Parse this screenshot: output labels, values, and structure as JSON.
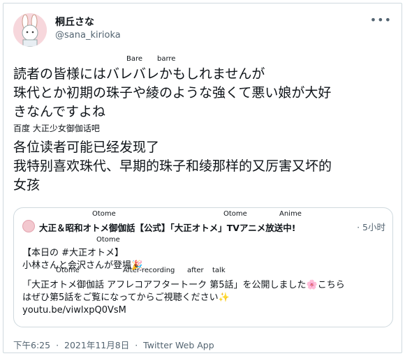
{
  "tweet": {
    "author_name": "桐丘さな",
    "author_handle": "@sana_kirioka",
    "more_icon": "more-dots-icon",
    "ruby_line1": [
      "Bare",
      "barre"
    ],
    "text_lines": [
      "読者の皆様にはバレバレかもしれませんが",
      "珠代とか初期の珠子や綾のような強くて悪い娘が大好",
      "きなんですよね"
    ],
    "translation_source": "百度 大正少女御伽话吧",
    "translation_lines": [
      "各位读者可能已经发现了",
      "我特别喜欢珠代、早期的珠子和绫那样的又厉害又坏的",
      "女孩"
    ]
  },
  "quoted": {
    "ruby_header": [
      "Otome",
      "Otome",
      "Anime"
    ],
    "name": "大正＆昭和オトメ御伽話【公式】「大正オトメ」TVアニメ放送中!",
    "time": "· 5小时",
    "ruby_line2": [
      "Otome"
    ],
    "ruby_line4": [
      "Otome",
      "After-recording",
      "after",
      "talk"
    ],
    "lines": [
      "【本日の #大正オトメ】",
      "小林さんと会沢さんが登場🎉",
      "「大正オトメ御伽話 アフレコアフタートーク 第5話」を公開しました🌸こちら",
      "はぜひ第5話をご覧になってからご視聴ください✨"
    ],
    "link": "youtu.be/viwlxpQ0VsM"
  },
  "footer": {
    "time": "下午6:25",
    "date": "2021年11月8日",
    "client": "Twitter Web App",
    "separator": "·"
  }
}
